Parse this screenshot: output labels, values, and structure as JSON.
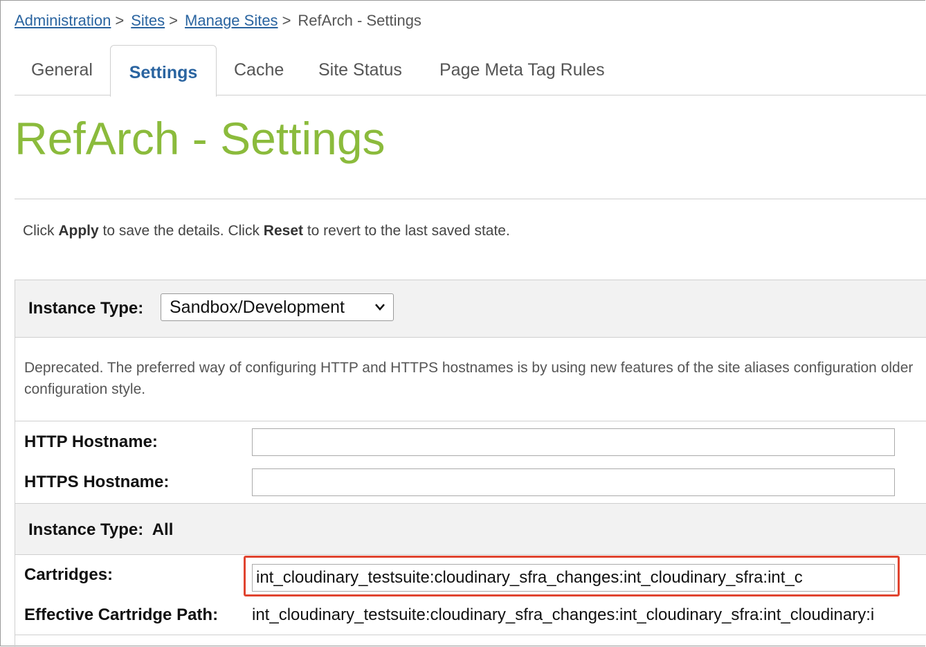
{
  "breadcrumb": {
    "items": [
      "Administration",
      "Sites",
      "Manage Sites"
    ],
    "separator": ">",
    "current": "RefArch - Settings"
  },
  "tabs": [
    {
      "label": "General",
      "active": false
    },
    {
      "label": "Settings",
      "active": true
    },
    {
      "label": "Cache",
      "active": false
    },
    {
      "label": "Site Status",
      "active": false
    },
    {
      "label": "Page Meta Tag Rules",
      "active": false
    }
  ],
  "page": {
    "title": "RefArch - Settings",
    "instructions": {
      "part1": "Click ",
      "apply": "Apply",
      "part2": " to save the details. Click ",
      "reset": "Reset",
      "part3": " to revert to the last saved state."
    }
  },
  "instance_type": {
    "label": "Instance Type:",
    "selected": "Sandbox/Development"
  },
  "deprecated_note": "Deprecated. The preferred way of configuring HTTP and HTTPS hostnames is by using new features of the site aliases configuration older configuration style.",
  "hostnames": {
    "http_label": "HTTP Hostname:",
    "http_value": "",
    "https_label": "HTTPS Hostname:",
    "https_value": ""
  },
  "instance_type_all": {
    "label": "Instance Type:",
    "value": "All"
  },
  "cartridges": {
    "label": "Cartridges:",
    "value": "int_cloudinary_testsuite:cloudinary_sfra_changes:int_cloudinary_sfra:int_c",
    "effective_label": "Effective Cartridge Path:",
    "effective_value": "int_cloudinary_testsuite:cloudinary_sfra_changes:int_cloudinary_sfra:int_cloudinary:i"
  },
  "colors": {
    "link": "#2a64a0",
    "title": "#8bbb3c",
    "highlight": "#e0442f"
  }
}
